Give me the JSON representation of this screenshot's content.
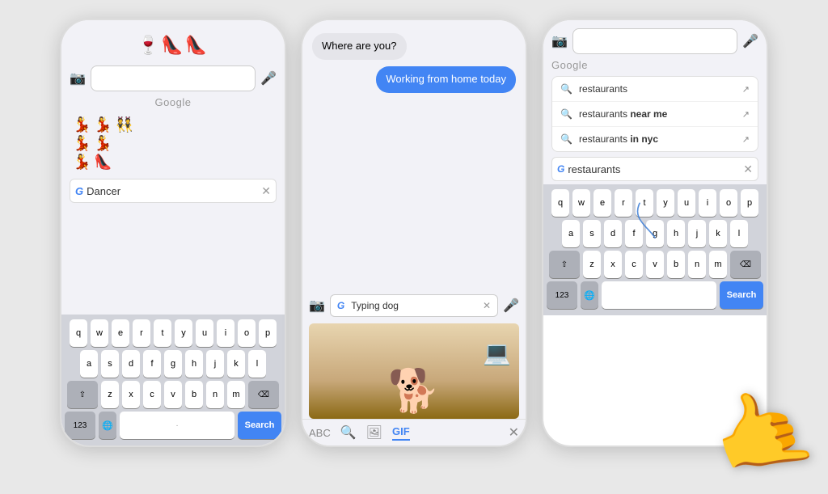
{
  "colors": {
    "blue": "#4285F4",
    "light_gray": "#f2f2f7",
    "keyboard_bg": "#d1d3da",
    "white": "#ffffff",
    "dark_key": "#adb0b8",
    "chat_bubble_received": "#e5e5ea",
    "chat_bubble_sent": "#4285F4",
    "text_dark": "#333333",
    "text_light": "#999999"
  },
  "phone1": {
    "emoji_top": "🍷👠👠",
    "search_placeholder": "",
    "google_label": "Google",
    "emoji_results": [
      [
        "💃",
        "💃",
        "👯"
      ],
      [
        "💃",
        "💃"
      ],
      [
        "💃",
        "👠"
      ]
    ],
    "typed_query": "Dancer",
    "keyboard_rows": [
      [
        "q",
        "w",
        "e",
        "r",
        "t",
        "y",
        "u",
        "i",
        "o",
        "p"
      ],
      [
        "a",
        "s",
        "d",
        "f",
        "g",
        "h",
        "j",
        "k",
        "l"
      ],
      [
        "⇧",
        "z",
        "x",
        "c",
        "v",
        "b",
        "n",
        "m",
        "⌫"
      ],
      [
        "123",
        "🌐",
        "",
        "",
        "",
        "",
        "",
        "",
        "·",
        "Search"
      ]
    ]
  },
  "phone2": {
    "chat_messages": [
      {
        "text": "Where are you?",
        "type": "received"
      },
      {
        "text": "Working from home today",
        "type": "sent"
      }
    ],
    "typed_query": "Typing dog",
    "bottom_bar": {
      "abc": "ABC",
      "search_icon": "🔍",
      "gif_label": "GIF",
      "close_icon": "✕"
    }
  },
  "phone3": {
    "suggestions": [
      {
        "text": "restaurants",
        "bold": false
      },
      {
        "text": "restaurants near me",
        "bold_word": "near me"
      },
      {
        "text": "restaurants in nyc",
        "bold_word": "in nyc"
      }
    ],
    "typed_query": "restaurants",
    "search_label": "Search",
    "google_label": "Google",
    "keyboard_rows": [
      [
        "q",
        "w",
        "e",
        "r",
        "t",
        "y",
        "u",
        "i",
        "o",
        "p"
      ],
      [
        "a",
        "s",
        "d",
        "f",
        "g",
        "h",
        "j",
        "k",
        "l"
      ],
      [
        "⇧",
        "z",
        "x",
        "c",
        "v",
        "b",
        "n",
        "m",
        "⌫"
      ],
      [
        "123",
        "🌐",
        "",
        "",
        "",
        "",
        "",
        "",
        "",
        "Search"
      ]
    ]
  },
  "icons": {
    "camera": "📷",
    "mic": "🎤",
    "search": "🔍",
    "clear": "✕",
    "globe": "🌐",
    "shift": "⇧",
    "backspace": "⌫"
  }
}
